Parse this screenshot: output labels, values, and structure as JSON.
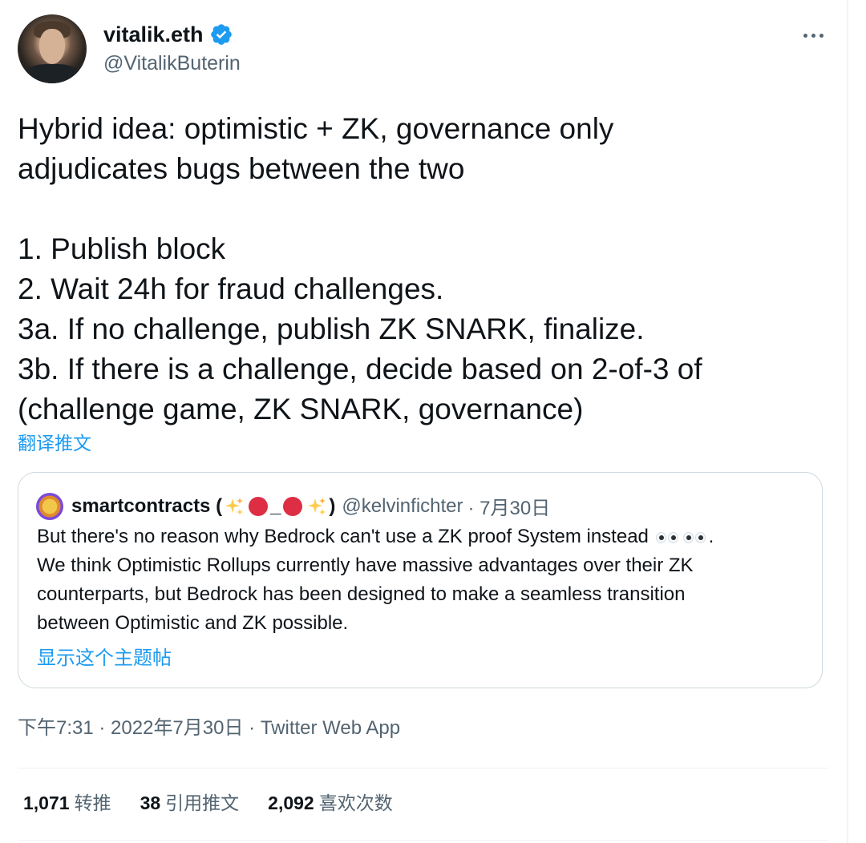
{
  "author": {
    "display_name": "vitalik.eth",
    "handle": "@VitalikButerin",
    "verified": true
  },
  "tweet": {
    "lines": [
      "Hybrid idea: optimistic + ZK, governance only",
      "adjudicates bugs between the two",
      "",
      "1. Publish block",
      "2. Wait 24h for fraud challenges.",
      "3a. If no challenge, publish ZK SNARK, finalize.",
      "3b. If there is a challenge, decide based on 2-of-3 of",
      "(challenge game, ZK SNARK, governance)"
    ],
    "translate_label": "翻译推文"
  },
  "quote": {
    "name_text": "smartcontracts (",
    "name_underscore": "_",
    "name_close": ")",
    "handle": "@kelvinfichter",
    "date": "· 7月30日",
    "line1_before_emoji": "But there's no reason why Bedrock can't use a ZK proof System instead",
    "line1_after_emoji": ".",
    "line2": "We think Optimistic Rollups currently have massive advantages over their ZK",
    "line3": "counterparts, but Bedrock has been designed to make a seamless transition",
    "line4": "between Optimistic and ZK possible.",
    "show_thread_label": "显示这个主题帖"
  },
  "meta": {
    "time": "下午7:31",
    "date": "2022年7月30日",
    "source": "Twitter Web App",
    "separator": " · "
  },
  "stats": {
    "retweets_count": "1,071",
    "retweets_label": "转推",
    "quotes_count": "38",
    "quotes_label": "引用推文",
    "likes_count": "2,092",
    "likes_label": "喜欢次数"
  },
  "colors": {
    "text_primary": "#0f1419",
    "text_secondary": "#536471",
    "link": "#1d9bf0",
    "border": "#cfd9de",
    "verified_badge": "#1d9bf0"
  },
  "icons": {
    "verified": "verified-badge-icon",
    "more": "more-dots-icon",
    "sparkle": "sparkles-emoji-icon",
    "red_dot": "red-circle-emoji-icon",
    "eyes": "eyes-emoji-icon"
  }
}
